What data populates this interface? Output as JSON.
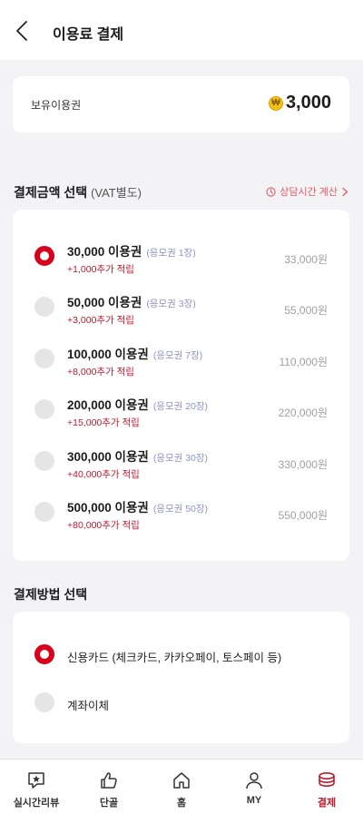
{
  "header": {
    "title": "이용료 결제"
  },
  "balance": {
    "label": "보유이용권",
    "coin_symbol": "₩",
    "value": "3,000"
  },
  "amount_section": {
    "title": "결제금액 선택",
    "subtitle": "(VAT별도)",
    "calc_link": "상담시간 계산",
    "options": [
      {
        "title": "30,000 이용권",
        "tickets": "(응모권 1장)",
        "bonus": "+1,000추가 적립",
        "price": "33,000원",
        "selected": true
      },
      {
        "title": "50,000 이용권",
        "tickets": "(응모권 3장)",
        "bonus": "+3,000추가 적립",
        "price": "55,000원",
        "selected": false
      },
      {
        "title": "100,000 이용권",
        "tickets": "(응모권 7장)",
        "bonus": "+8,000추가 적립",
        "price": "110,000원",
        "selected": false
      },
      {
        "title": "200,000 이용권",
        "tickets": "(응모권 20장)",
        "bonus": "+15,000추가 적립",
        "price": "220,000원",
        "selected": false
      },
      {
        "title": "300,000 이용권",
        "tickets": "(응모권 30장)",
        "bonus": "+40,000추가 적립",
        "price": "330,000원",
        "selected": false
      },
      {
        "title": "500,000 이용권",
        "tickets": "(응모권 50장)",
        "bonus": "+80,000추가 적립",
        "price": "550,000원",
        "selected": false
      }
    ]
  },
  "method_section": {
    "title": "결제방법 선택",
    "methods": [
      {
        "label": "신용카드 (체크카드, 카카오페이, 토스페이 등)",
        "selected": true
      },
      {
        "label": "계좌이체",
        "selected": false
      }
    ]
  },
  "tabbar": {
    "tabs": [
      {
        "label": "실시간리뷰",
        "icon": "review-star-icon"
      },
      {
        "label": "단골",
        "icon": "thumbs-up-icon"
      },
      {
        "label": "홈",
        "icon": "home-icon"
      },
      {
        "label": "MY",
        "icon": "person-icon"
      },
      {
        "label": "결제",
        "icon": "coins-icon",
        "active": true
      }
    ]
  },
  "colors": {
    "accent": "#d9001b",
    "bonus": "#c0192c",
    "link": "#e05a6a",
    "tickets": "#8f93c7"
  }
}
